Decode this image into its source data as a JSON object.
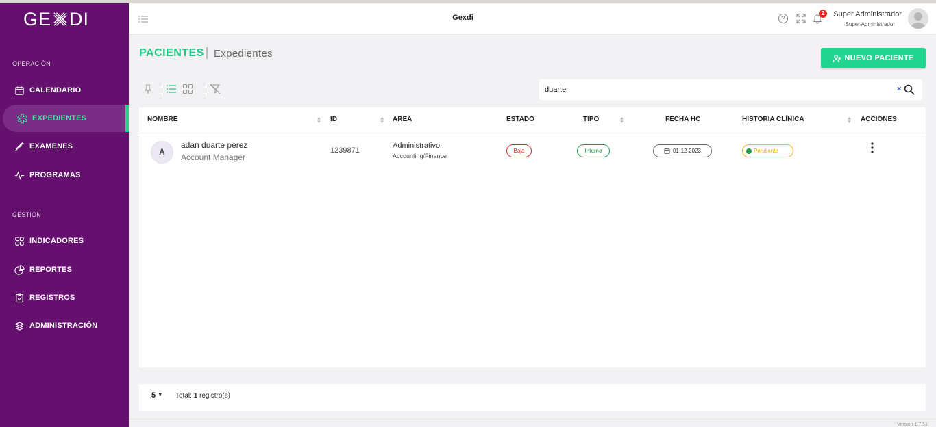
{
  "app": {
    "logo_text_left": "GE",
    "logo_text_right": "DI"
  },
  "header": {
    "title": "Gexdi",
    "notification_count": "2",
    "user_name": "Super Administrador",
    "user_role": "Super Administrador"
  },
  "sidebar": {
    "section_operacion": "OPERACIÓN",
    "section_gestion": "GESTIÓN",
    "items": [
      {
        "label": "CALENDARIO",
        "icon": "calendar-icon"
      },
      {
        "label": "EXPEDIENTES",
        "icon": "medical-icon",
        "active": true
      },
      {
        "label": "EXAMENES",
        "icon": "syringe-icon"
      },
      {
        "label": "PROGRAMAS",
        "icon": "pulse-icon"
      },
      {
        "label": "INDICADORES",
        "icon": "grid-icon"
      },
      {
        "label": "REPORTES",
        "icon": "pie-chart-icon"
      },
      {
        "label": "REGISTROS",
        "icon": "clipboard-icon"
      },
      {
        "label": "ADMINISTRACIÓN",
        "icon": "layers-icon"
      }
    ]
  },
  "page": {
    "title": "PACIENTES",
    "subtitle": "Expedientes",
    "new_button": "NUEVO PACIENTE"
  },
  "search": {
    "value": "duarte"
  },
  "table": {
    "headers": [
      "NOMBRE",
      "ID",
      "AREA",
      "ESTADO",
      "TIPO",
      "FECHA HC",
      "HISTORIA CLÍNICA",
      "ACCIONES"
    ],
    "rows": [
      {
        "initial": "A",
        "name": "adan duarte perez",
        "position": "Account Manager",
        "id": "1239871",
        "area": "Administrativo",
        "area_sub": "Accounting/Finance",
        "estado": "Baja",
        "tipo": "Interno",
        "fecha_hc": "01-12-2023",
        "historia": "Pendiente"
      }
    ]
  },
  "footer": {
    "page_size": "5",
    "total_prefix": "Total:",
    "total_count": "1",
    "total_suffix": "registro(s)",
    "version": "Versión 1.7.51"
  },
  "colors": {
    "sidebar_bg": "#65106e",
    "accent_green": "#22d48f",
    "estado_baja": "#d42a2a",
    "tipo_interno": "#1e9b4f",
    "historia_pendiente": "#f2b31c"
  }
}
